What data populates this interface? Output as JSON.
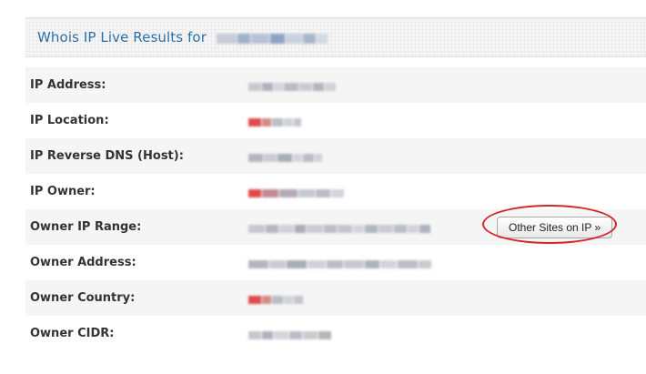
{
  "header": {
    "title": "Whois IP Live Results for",
    "domain_redacted": true
  },
  "rows": [
    {
      "label": "IP Address:",
      "value_redacted": true
    },
    {
      "label": "IP Location:",
      "value_redacted": true
    },
    {
      "label": "IP Reverse DNS (Host):",
      "value_redacted": true
    },
    {
      "label": "IP Owner:",
      "value_redacted": true
    },
    {
      "label": "Owner IP Range:",
      "value_redacted": true,
      "button": "Other Sites on IP »"
    },
    {
      "label": "Owner Address:",
      "value_redacted": true
    },
    {
      "label": "Owner Country:",
      "value_redacted": true
    },
    {
      "label": "Owner CIDR:",
      "value_redacted": true
    }
  ],
  "colors": {
    "title": "#2a70a8",
    "label": "#333333",
    "annotation": "#d4252c"
  }
}
